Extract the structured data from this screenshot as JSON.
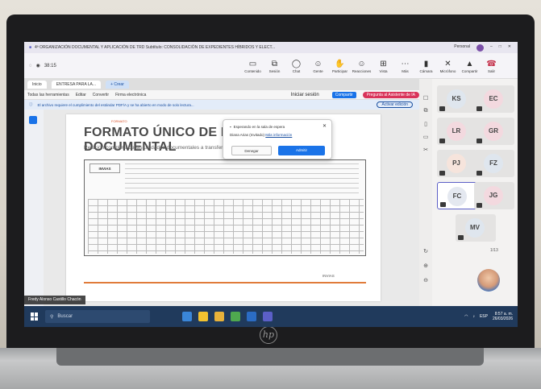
{
  "window": {
    "title": "4ª ORGANIZACIÓN DOCUMENTAL Y APLICACIÓN DE TRD Subtítulo: CONSOLIDACIÓN DE EXPEDIENTES HÍBRIDOS Y ELECT...",
    "user_label": "Personal"
  },
  "meeting": {
    "timer": "38:15",
    "actions": [
      {
        "label": "Contenido",
        "icon": "▭"
      },
      {
        "label": "Sesión",
        "icon": "⧉"
      },
      {
        "label": "Chat",
        "icon": "◯"
      },
      {
        "label": "Gente",
        "icon": "☺"
      },
      {
        "label": "Participar",
        "icon": "✋"
      },
      {
        "label": "Reacciones",
        "icon": "☺"
      },
      {
        "label": "Vista",
        "icon": "⊞"
      },
      {
        "label": "Más",
        "icon": "⋯"
      }
    ],
    "right_actions": [
      {
        "label": "Cámara",
        "icon": "▮"
      },
      {
        "label": "Micrófono",
        "icon": "✕"
      },
      {
        "label": "Compartir",
        "icon": "▲"
      },
      {
        "label": "Salir",
        "icon": "☎"
      }
    ]
  },
  "browser": {
    "tabs": [
      "Inicio",
      "ENTRESA PARA LA...",
      "+ Crear"
    ],
    "toolbar": [
      "Todas las herramientas",
      "Editar",
      "Convertir",
      "Firma electrónica"
    ],
    "signin": "Iniciar sesión",
    "share_label": "Compartir",
    "ai_label": "Pregunta al Asistente de IA",
    "banner_text": "El archivo requiere el cumplimiento del estándar PDF/A y se ha abierto en modo de solo lectura...",
    "edit_button": "Activar edición"
  },
  "document": {
    "tag": "FORMATO",
    "title": "FORMATO ÚNICO DE INVENTARIO DOCUMENTAL",
    "subtitle": "Relación completa de las unidades documentales a transferir, organizada por series y subseries.",
    "form_logo": "INVIAS",
    "footer_logo": "INVIAS"
  },
  "popup": {
    "title": "Esperando en la sala de espera",
    "body": "Diana Arias (Invitado)",
    "link": "Más información",
    "deny": "Denegar",
    "admit": "Admitir"
  },
  "participants": {
    "tiles": [
      {
        "initials": "KS",
        "color": "#dfe6ee"
      },
      {
        "initials": "EC",
        "color": "#f3d9df"
      },
      {
        "initials": "LR",
        "color": "#f3d9df"
      },
      {
        "initials": "GR",
        "color": "#f3d9df"
      },
      {
        "initials": "PJ",
        "color": "#f6e4dc"
      },
      {
        "initials": "FZ",
        "color": "#dfe6ee"
      },
      {
        "initials": "FC",
        "color": "#e4e8f0"
      },
      {
        "initials": "JG",
        "color": "#f3d9df"
      },
      {
        "initials": "MV",
        "color": "#dfe6ee"
      }
    ],
    "page": "1/13"
  },
  "taskbar": {
    "search": "Buscar",
    "time": "8:57 a. m.",
    "date": "26/03/2026",
    "presenter": "Fredy Alonso Castillo Chacón",
    "lang": "ESP"
  }
}
